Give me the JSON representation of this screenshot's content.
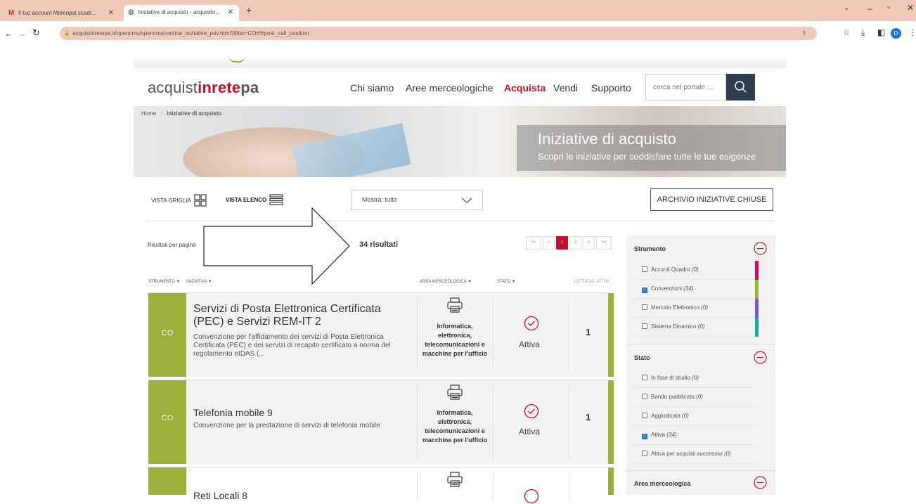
{
  "browser": {
    "tabs": [
      {
        "label": "Il tuo account Memopal scadr..."
      },
      {
        "label": "Iniziative di acquisto - acquistin..."
      }
    ],
    "url": "acquistinretepa.it/opencms/opencms/vetrina_iniziative_priv.html?filter=CO#!#post_call_position",
    "avatar_letter": "D"
  },
  "site": {
    "logo": {
      "part1": "acquist",
      "part2": "inrete",
      "part3": "pa"
    },
    "nav": [
      "Chi siamo",
      "Aree merceologiche",
      "Acquista",
      "Vendi",
      "Supporto"
    ],
    "search_placeholder": "cerca nel portale ..."
  },
  "breadcrumb": {
    "home": "Home",
    "sep": "/",
    "current": "Iniziative di acquisto"
  },
  "hero": {
    "title": "Iniziative di acquisto",
    "subtitle": "Scopri le iniziative per soddisfare tutte le tue esigenze"
  },
  "toolbar": {
    "vista_griglia": "VISTA GRIGLIA",
    "vista_elenco": "VISTA ELENCO",
    "mostra": "Mostra: tutte",
    "archivio": "ARCHIVIO INIZIATIVE CHIUSE"
  },
  "results": {
    "per_page_label": "Risultati per pagina",
    "count": "34 risultati",
    "pagination": [
      "<<",
      "<",
      "1",
      "2",
      ">",
      ">>"
    ]
  },
  "table_headers": {
    "strumento": "STRUMENTO",
    "iniziativa": "INIZIATIVA",
    "area": "AREA MERCEOLOGICA",
    "stato": "STATO",
    "lotti": "LOTTI/CAT. ATTIVI"
  },
  "rows": [
    {
      "code": "CO",
      "title": "Servizi di Posta Elettronica Certificata (PEC) e Servizi REM-IT 2",
      "desc": "Convenzione per l'affidamento dei servizi di Posta Elettronica Certificata (PEC) e dei servizi di recapito certificato a norma del regolamento eIDAS (...",
      "area": "Informatica, elettronica, telecomunicazioni e macchine per l'ufficio",
      "stato": "Attiva",
      "lotti": "1"
    },
    {
      "code": "CO",
      "title": "Telefonia mobile 9",
      "desc": "Convenzione per la prestazione di servizi di telefonia mobile",
      "area": "Informatica, elettronica, telecomunicazioni e macchine per l'ufficio",
      "stato": "Attiva",
      "lotti": "1"
    },
    {
      "code": "",
      "title": "Reti Locali 8",
      "desc": "",
      "area": "",
      "stato": "",
      "lotti": ""
    }
  ],
  "filters": {
    "strumento": {
      "title": "Strumento",
      "items": [
        {
          "label": "Accordi Quadro",
          "count": "(0)",
          "checked": false,
          "color": "#c2185b"
        },
        {
          "label": "Convenzioni",
          "count": "(34)",
          "checked": true,
          "color": "#9eaf3c"
        },
        {
          "label": "Mercato Elettronico",
          "count": "(0)",
          "checked": false,
          "color": "#7e57c2"
        },
        {
          "label": "Sistema Dinamico",
          "count": "(0)",
          "checked": false,
          "color": "#26a69a"
        }
      ]
    },
    "stato": {
      "title": "Stato",
      "items": [
        {
          "label": "In fase di studio",
          "count": "(0)",
          "checked": false
        },
        {
          "label": "Bando pubblicato",
          "count": "(0)",
          "checked": false
        },
        {
          "label": "Aggiudicata",
          "count": "(0)",
          "checked": false
        },
        {
          "label": "Attiva",
          "count": "(34)",
          "checked": true
        },
        {
          "label": "Attiva per acquisti successivi",
          "count": "(0)",
          "checked": false
        }
      ]
    },
    "area": {
      "title": "Area merceologica"
    }
  },
  "colors": {
    "brand_red": "#c8102e",
    "accent_green": "#9eaf3c",
    "chrome_tab": "#f0c9b8",
    "search_btn": "#2c3e50"
  }
}
